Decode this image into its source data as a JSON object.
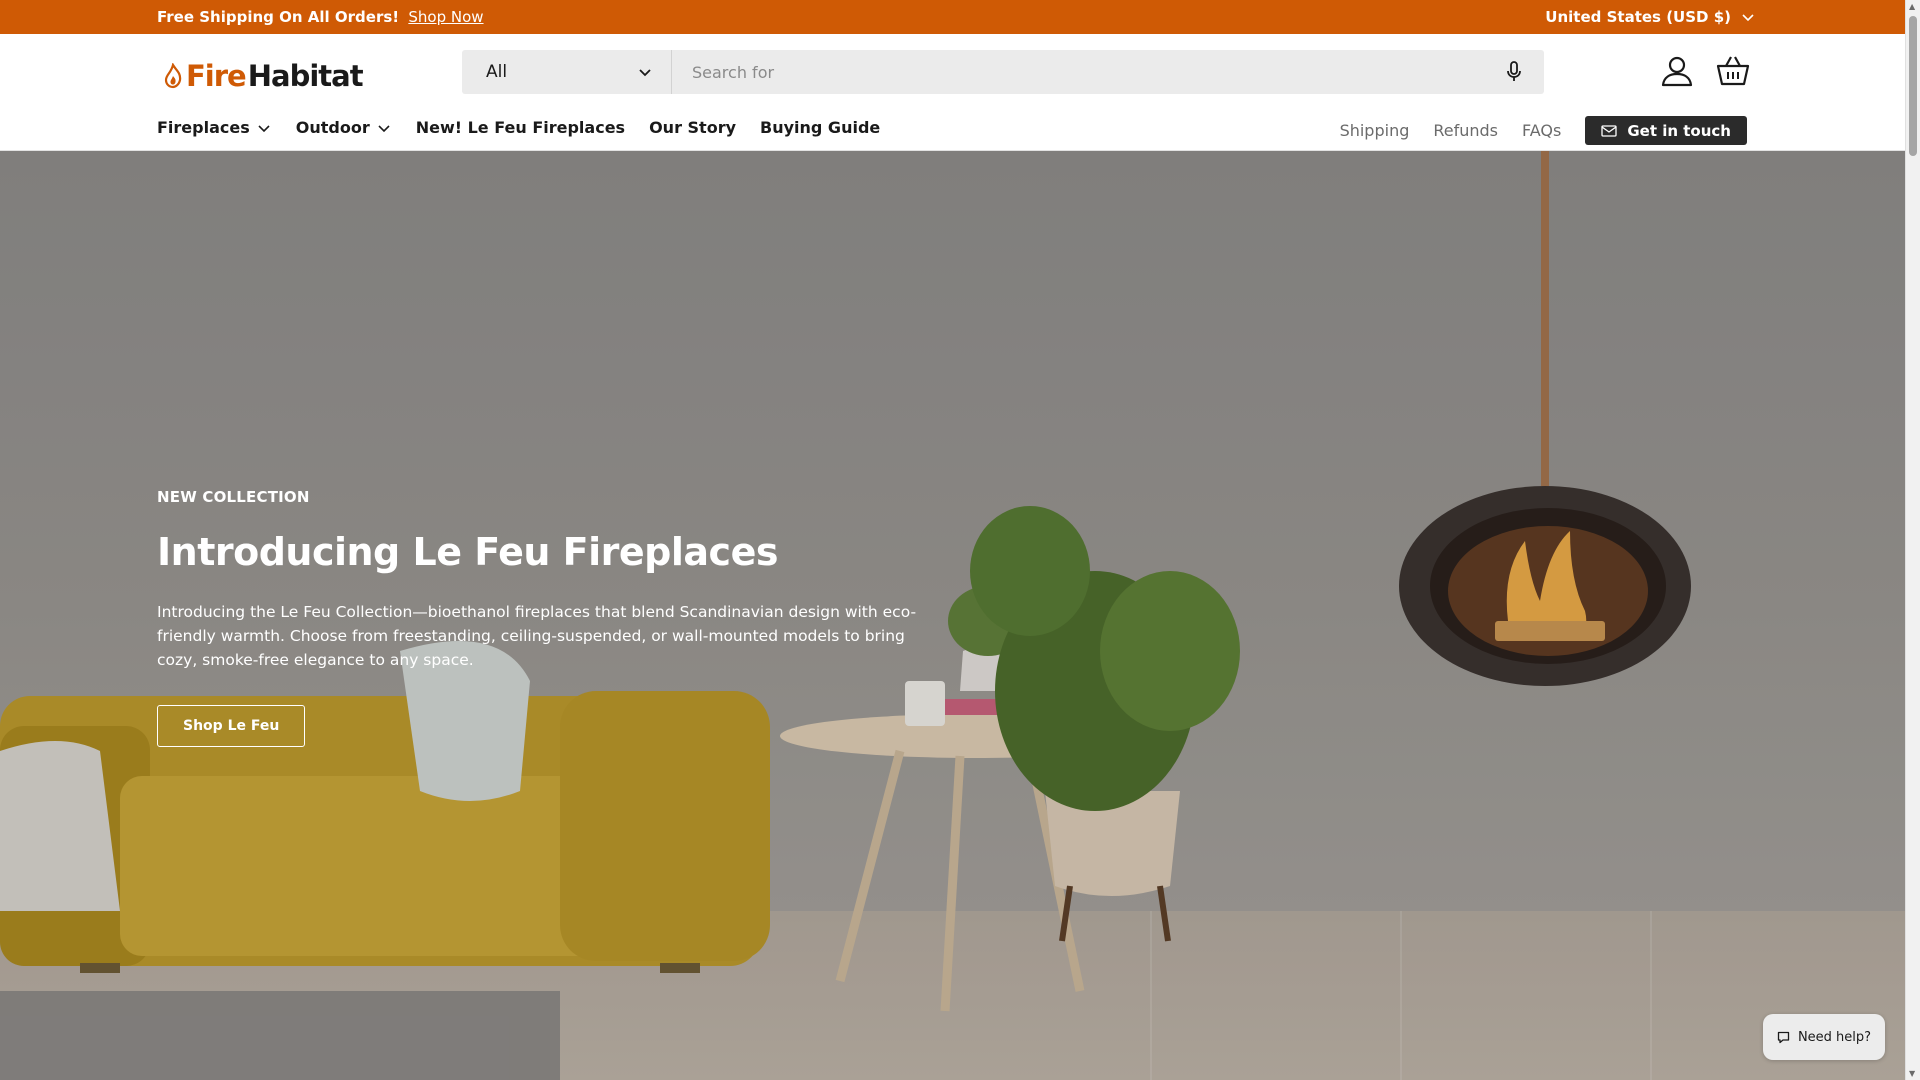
{
  "announcement": {
    "message": "Free Shipping On All Orders!",
    "link": "Shop Now",
    "country": "United States (USD $)"
  },
  "header": {
    "logo_fire": "Fire",
    "logo_habitat": "Habitat",
    "search": {
      "category": "All",
      "placeholder": "Search for"
    },
    "icons": [
      "account-icon",
      "basket-icon"
    ]
  },
  "nav": {
    "items": [
      {
        "label": "Fireplaces",
        "dropdown": true
      },
      {
        "label": "Outdoor",
        "dropdown": true
      },
      {
        "label": "New! Le Feu Fireplaces",
        "dropdown": false
      },
      {
        "label": "Our Story",
        "dropdown": false
      },
      {
        "label": "Buying Guide",
        "dropdown": false
      }
    ],
    "secondary": [
      "Shipping",
      "Refunds",
      "FAQs"
    ],
    "contact": "Get in touch"
  },
  "hero": {
    "eyebrow": "NEW COLLECTION",
    "title": "Introducing Le Feu Fireplaces",
    "body": "Introducing the Le Feu Collection—bioethanol fireplaces that blend Scandinavian design with eco-friendly warmth. Choose from freestanding, ceiling-suspended, or wall-mounted models to bring cozy, smoke-free elegance to any space.",
    "cta": "Shop Le Feu"
  },
  "chat": {
    "label": "Need help?"
  },
  "colors": {
    "brand": "#cf5a05",
    "contact_button": "#2b2b2b"
  }
}
